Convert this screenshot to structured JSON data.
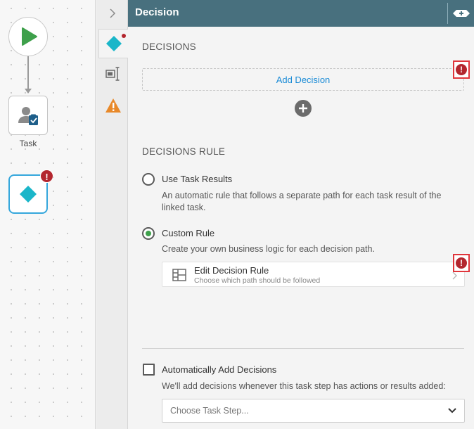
{
  "canvas": {
    "task_label": "Task",
    "node_error_symbol": "!"
  },
  "tabs": [
    {
      "name": "decision-tab",
      "icon": "diamond-icon",
      "active": true
    },
    {
      "name": "form-tab",
      "icon": "text-field-icon",
      "active": false
    },
    {
      "name": "warnings-tab",
      "icon": "warning-icon",
      "active": false
    }
  ],
  "panel": {
    "title": "Decision",
    "decisions_heading": "DECISIONS",
    "add_decision_label": "Add Decision",
    "error_symbol": "!",
    "rule_heading": "DECISIONS RULE",
    "options": [
      {
        "label": "Use Task Results",
        "description": "An automatic rule that follows a separate path for each task result of the linked task.",
        "checked": false
      },
      {
        "label": "Custom Rule",
        "description": "Create your own business logic for each decision path.",
        "checked": true
      }
    ],
    "rule_card": {
      "title": "Edit Decision Rule",
      "subtitle": "Choose which path should be followed"
    },
    "auto_add": {
      "label": "Automatically Add Decisions",
      "description": "We'll add decisions whenever this task step has actions or results added:",
      "checked": false
    },
    "task_step_select": {
      "placeholder": "Choose Task Step..."
    }
  },
  "colors": {
    "header": "#48707e",
    "accent_cyan": "#1ab6c9",
    "error": "#b3262e",
    "error_outline": "#e0353b",
    "link": "#1a8bd6",
    "start_green": "#3ea04b",
    "warning_orange": "#e8892a"
  }
}
